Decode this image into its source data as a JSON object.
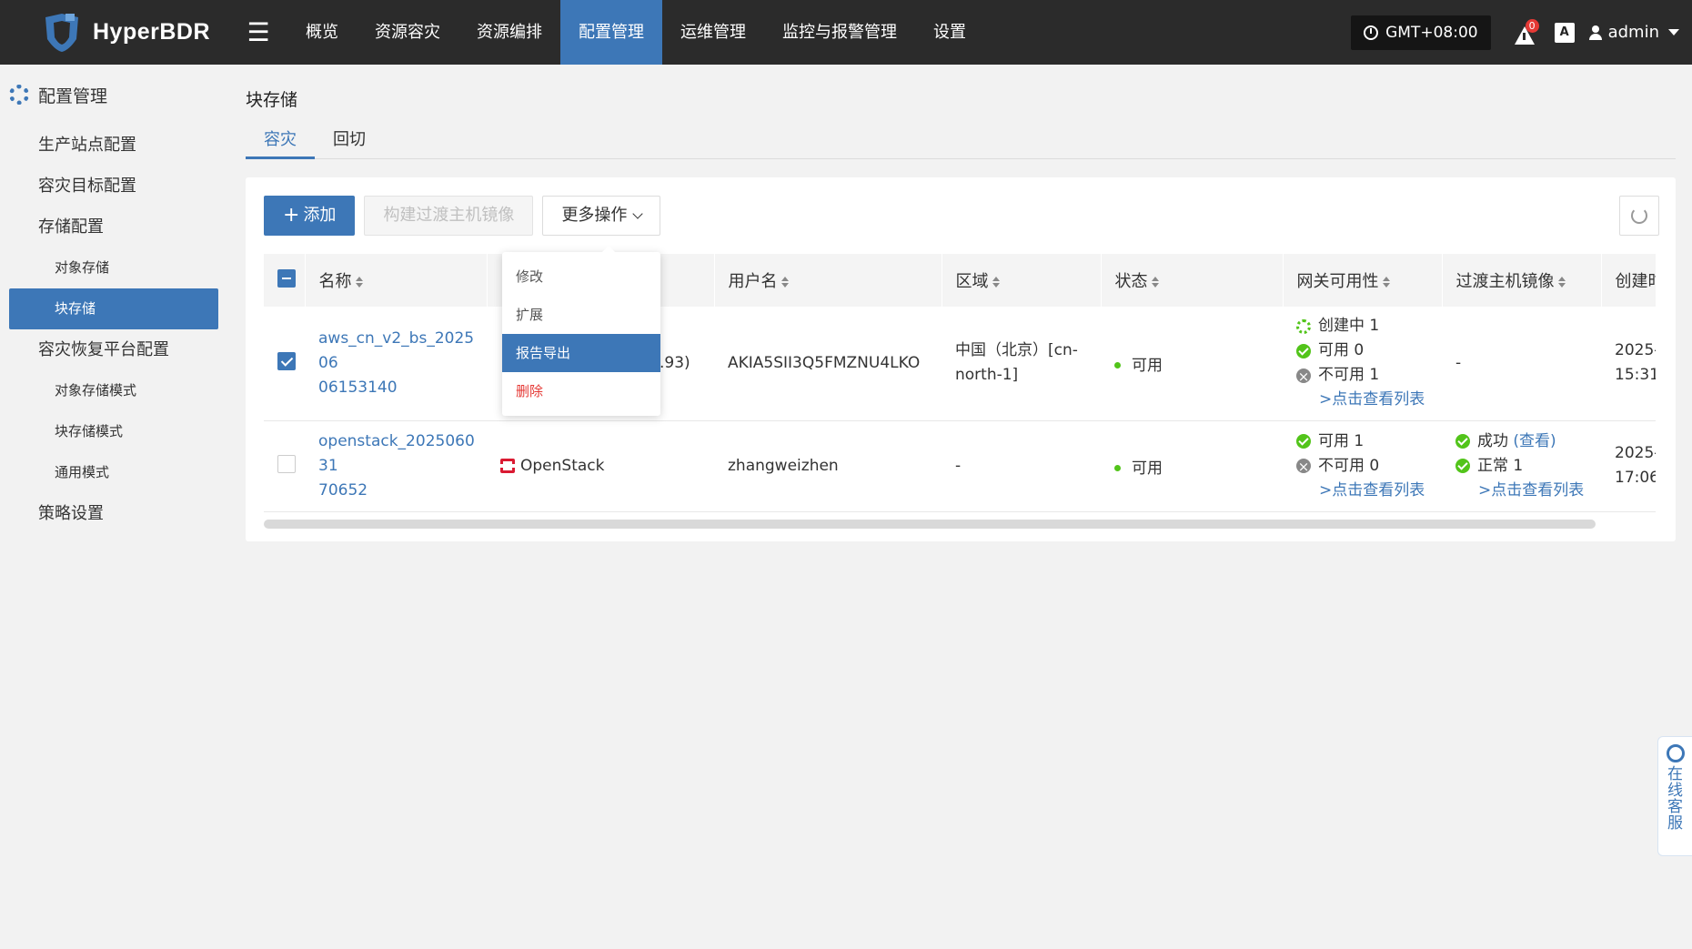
{
  "app": {
    "brand": "HyperBDR",
    "menu_icon": "hamburger-icon"
  },
  "nav": [
    {
      "label": "概览",
      "active": false
    },
    {
      "label": "资源容灾",
      "active": false
    },
    {
      "label": "资源编排",
      "active": false
    },
    {
      "label": "配置管理",
      "active": true
    },
    {
      "label": "运维管理",
      "active": false
    },
    {
      "label": "监控与报警管理",
      "active": false
    },
    {
      "label": "设置",
      "active": false
    }
  ],
  "topbar": {
    "timezone": "GMT+08:00",
    "alert_count": "0",
    "lang_icon": "A",
    "user": "admin"
  },
  "sidebar": {
    "title": "配置管理",
    "items": [
      {
        "label": "生产站点配置",
        "level": 1
      },
      {
        "label": "容灾目标配置",
        "level": 1
      },
      {
        "label": "存储配置",
        "level": 1
      },
      {
        "label": "对象存储",
        "level": 2
      },
      {
        "label": "块存储",
        "level": 2,
        "active": true
      },
      {
        "label": "容灾恢复平台配置",
        "level": 1
      },
      {
        "label": "对象存储模式",
        "level": 2
      },
      {
        "label": "块存储模式",
        "level": 2
      },
      {
        "label": "通用模式",
        "level": 2
      },
      {
        "label": "策略设置",
        "level": 1
      }
    ]
  },
  "page": {
    "title": "块存储",
    "tabs": [
      {
        "label": "容灾",
        "active": true
      },
      {
        "label": "回切",
        "active": false
      }
    ]
  },
  "toolbar": {
    "add": "添加",
    "build_image": "构建过渡主机镜像",
    "more": "更多操作"
  },
  "dropdown": [
    {
      "label": "修改",
      "state": "normal"
    },
    {
      "label": "扩展",
      "state": "normal"
    },
    {
      "label": "报告导出",
      "state": "active"
    },
    {
      "label": "删除",
      "state": "danger"
    }
  ],
  "table": {
    "columns": [
      "名称",
      "",
      "用户名",
      "区域",
      "状态",
      "网关可用性",
      "过渡主机镜像",
      "创建时"
    ],
    "rows": [
      {
        "name": "aws_cn_v2_bs_20250606153140",
        "name_l1": "aws_cn_v2_bs_202506",
        "name_l2": "06153140",
        "platform": ".93)",
        "username": "AKIA5SII3Q5FMZNU4LKO",
        "region_l1": "中国（北京）[cn-",
        "region_l2": "north-1]",
        "status": "可用",
        "gateway": {
          "creating": "创建中 1",
          "ok": "可用 0",
          "bad": "不可用 1",
          "link": ">点击查看列表"
        },
        "image": "-",
        "created_l1": "2025-",
        "created_l2": "15:31:",
        "checked": true
      },
      {
        "name": "openstack_20250603170652",
        "name_l1": "openstack_202506031",
        "name_l2": "70652",
        "platform": "OpenStack",
        "username": "zhangweizhen",
        "region": "-",
        "status": "可用",
        "gateway": {
          "ok": "可用 1",
          "bad": "不可用 0",
          "link": ">点击查看列表"
        },
        "image": {
          "success": "成功",
          "view": "(查看)",
          "normal": "正常 1",
          "link": ">点击查看列表"
        },
        "created_l1": "2025-",
        "created_l2": "17:06:",
        "checked": false
      }
    ]
  },
  "service": {
    "label": "在线客服"
  }
}
